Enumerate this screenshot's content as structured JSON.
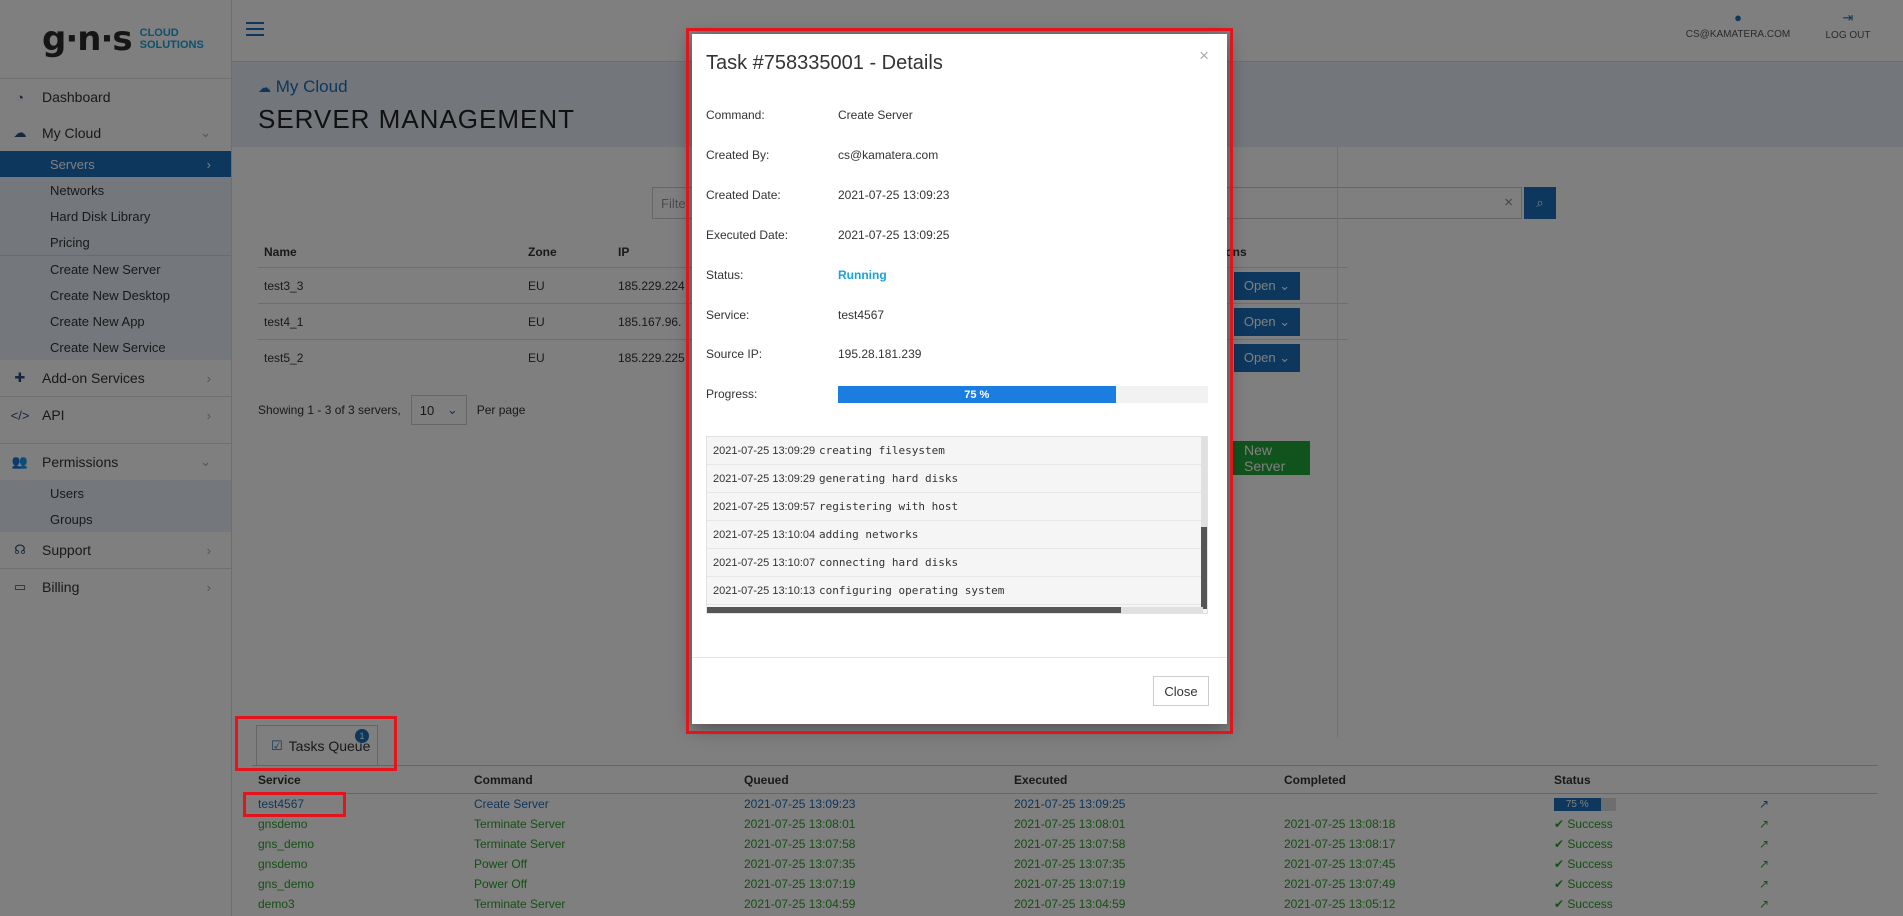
{
  "logo": {
    "main": "g·n·s",
    "sub_line1": "CLOUD",
    "sub_line2": "SOLUTIONS"
  },
  "sidebar": {
    "dashboard": "Dashboard",
    "my_cloud": "My Cloud",
    "my_cloud_items": [
      "Servers",
      "Networks",
      "Hard Disk Library",
      "Pricing"
    ],
    "create_items": [
      "Create New Server",
      "Create New Desktop",
      "Create New App",
      "Create New Service"
    ],
    "addon": "Add-on Services",
    "api": "API",
    "permissions": "Permissions",
    "permission_items": [
      "Users",
      "Groups"
    ],
    "support": "Support",
    "billing": "Billing"
  },
  "topbar": {
    "user": "CS@KAMATERA.COM",
    "logout": "LOG OUT"
  },
  "header": {
    "breadcrumb": "My Cloud",
    "title": "SERVER MANAGEMENT"
  },
  "filter": {
    "placeholder": "Filte",
    "clear": "×"
  },
  "servers": {
    "columns": {
      "name": "Name",
      "zone": "Zone",
      "ip": "IP",
      "actions": "tions"
    },
    "rows": [
      {
        "name": "test3_3",
        "zone": "EU",
        "ip": "185.229.224",
        "action": "Open"
      },
      {
        "name": "test4_1",
        "zone": "EU",
        "ip": "185.167.96.",
        "action": "Open"
      },
      {
        "name": "test5_2",
        "zone": "EU",
        "ip": "185.229.225",
        "action": "Open"
      }
    ],
    "showing": "Showing 1 - 3 of 3 servers,",
    "per_page_value": "10",
    "per_page_label": "Per page",
    "new_server": "New Server"
  },
  "tasks_queue": {
    "tab_label": "Tasks Queue",
    "badge": "1",
    "columns": {
      "service": "Service",
      "command": "Command",
      "queued": "Queued",
      "executed": "Executed",
      "completed": "Completed",
      "status": "Status"
    },
    "rows": [
      {
        "service": "test4567",
        "command": "Create Server",
        "queued": "2021-07-25 13:09:23",
        "executed": "2021-07-25 13:09:25",
        "completed": "",
        "status": "75 %",
        "progress": 0.75
      },
      {
        "service": "gnsdemo",
        "command": "Terminate Server",
        "queued": "2021-07-25 13:08:01",
        "executed": "2021-07-25 13:08:01",
        "completed": "2021-07-25 13:08:18",
        "status": "Success"
      },
      {
        "service": "gns_demo",
        "command": "Terminate Server",
        "queued": "2021-07-25 13:07:58",
        "executed": "2021-07-25 13:07:58",
        "completed": "2021-07-25 13:08:17",
        "status": "Success"
      },
      {
        "service": "gnsdemo",
        "command": "Power Off",
        "queued": "2021-07-25 13:07:35",
        "executed": "2021-07-25 13:07:35",
        "completed": "2021-07-25 13:07:45",
        "status": "Success"
      },
      {
        "service": "gns_demo",
        "command": "Power Off",
        "queued": "2021-07-25 13:07:19",
        "executed": "2021-07-25 13:07:19",
        "completed": "2021-07-25 13:07:49",
        "status": "Success"
      },
      {
        "service": "demo3",
        "command": "Terminate Server",
        "queued": "2021-07-25 13:04:59",
        "executed": "2021-07-25 13:04:59",
        "completed": "2021-07-25 13:05:12",
        "status": "Success"
      }
    ]
  },
  "modal": {
    "title": "Task #758335001 - Details",
    "close_x": "×",
    "fields": [
      {
        "key": "Command:",
        "value": "Create Server"
      },
      {
        "key": "Created By:",
        "value": "cs@kamatera.com"
      },
      {
        "key": "Created Date:",
        "value": "2021-07-25 13:09:23"
      },
      {
        "key": "Executed Date:",
        "value": "2021-07-25 13:09:25"
      },
      {
        "key": "Status:",
        "value": "Running"
      },
      {
        "key": "Service:",
        "value": "test4567"
      },
      {
        "key": "Source IP:",
        "value": "195.28.181.239"
      }
    ],
    "progress_label": "Progress:",
    "progress_text": "75 %",
    "progress": 0.75,
    "log": [
      {
        "time": "2021-07-25 13:09:29",
        "msg": "creating filesystem"
      },
      {
        "time": "2021-07-25 13:09:29",
        "msg": "generating hard disks"
      },
      {
        "time": "2021-07-25 13:09:57",
        "msg": "registering with host"
      },
      {
        "time": "2021-07-25 13:10:04",
        "msg": "adding networks"
      },
      {
        "time": "2021-07-25 13:10:07",
        "msg": "connecting hard disks"
      },
      {
        "time": "2021-07-25 13:10:13",
        "msg": "configuring operating system"
      }
    ],
    "close_button": "Close"
  },
  "colors": {
    "accent": "#1b6fb9",
    "success": "#2aa02a",
    "highlight": "#e4141c",
    "new_server": "#22a73a"
  }
}
